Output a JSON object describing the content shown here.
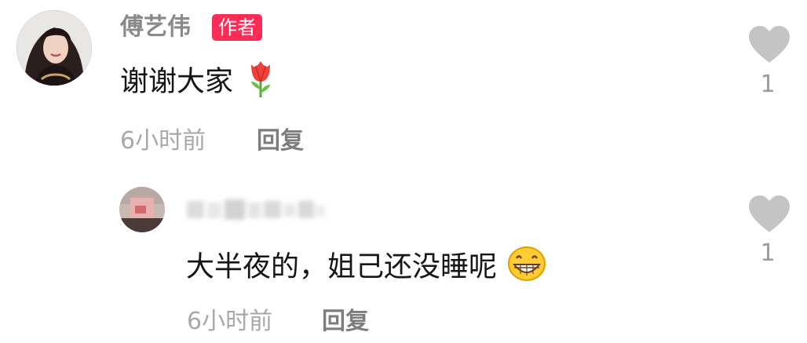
{
  "comments": [
    {
      "username": "傅艺伟",
      "badge": "作者",
      "text": "谢谢大家",
      "emoji": "tulip-emoji",
      "time": "6小时前",
      "reply_label": "回复",
      "likes": "1"
    },
    {
      "username": "",
      "username_blurred": true,
      "text": "大半夜的，姐己还没睡呢",
      "emoji": "grinning-emoji",
      "time": "6小时前",
      "reply_label": "回复",
      "likes": "1"
    }
  ],
  "colors": {
    "badge_bg": "#fe2c55",
    "name": "#8a8a8a",
    "meta": "#a8a8a8",
    "heart": "#c4c4c4"
  }
}
